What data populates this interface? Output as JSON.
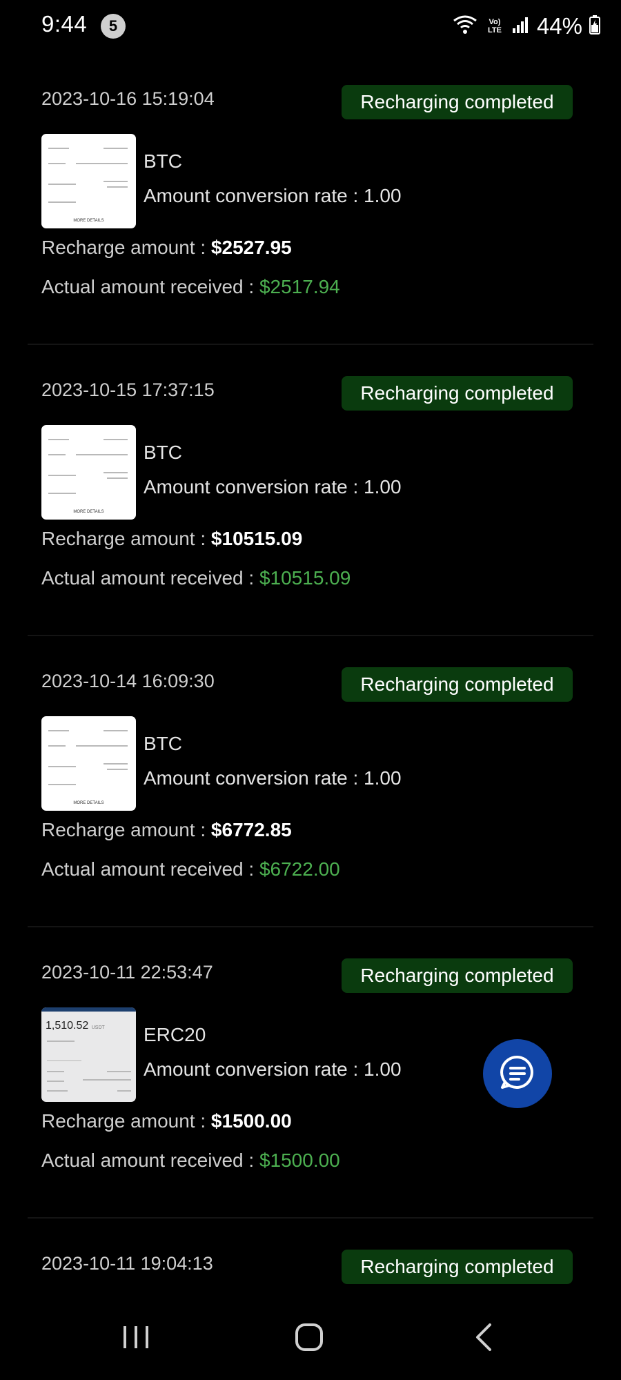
{
  "status_bar": {
    "time": "9:44",
    "notification_count": "5",
    "network_label": "Vo) LTE",
    "battery": "44%"
  },
  "records": [
    {
      "datetime": "2023-10-16 15:19:04",
      "status": "Recharging completed",
      "coin": "BTC",
      "rate_label": "Amount conversion rate : ",
      "rate_value": "1.00",
      "recharge_label": "Recharge amount : ",
      "recharge_value": "$2527.95",
      "received_label": "Actual amount received : ",
      "received_value": "$2517.94",
      "thumb_text": "MORE DETAILS"
    },
    {
      "datetime": "2023-10-15 17:37:15",
      "status": "Recharging completed",
      "coin": "BTC",
      "rate_label": "Amount conversion rate : ",
      "rate_value": "1.00",
      "recharge_label": "Recharge amount : ",
      "recharge_value": "$10515.09",
      "received_label": "Actual amount received : ",
      "received_value": "$10515.09",
      "thumb_text": "MORE DETAILS"
    },
    {
      "datetime": "2023-10-14 16:09:30",
      "status": "Recharging completed",
      "coin": "BTC",
      "rate_label": "Amount conversion rate : ",
      "rate_value": "1.00",
      "recharge_label": "Recharge amount : ",
      "recharge_value": "$6772.85",
      "received_label": "Actual amount received : ",
      "received_value": "$6722.00",
      "thumb_text": "MORE DETAILS"
    },
    {
      "datetime": "2023-10-11 22:53:47",
      "status": "Recharging completed",
      "coin": "ERC20",
      "rate_label": "Amount conversion rate : ",
      "rate_value": "1.00",
      "recharge_label": "Recharge amount : ",
      "recharge_value": "$1500.00",
      "received_label": "Actual amount received : ",
      "received_value": "$1500.00",
      "thumb_amount": "1,510.52",
      "thumb_unit": "USDT"
    },
    {
      "datetime": "2023-10-11 19:04:13",
      "status": "Recharging completed"
    }
  ],
  "colors": {
    "status_badge_bg": "#0a3b0e",
    "received_green": "#4caf50",
    "fab_blue": "#1145a7"
  },
  "icons": {
    "fab": "chat-bubble-icon",
    "nav": [
      "recent-apps-icon",
      "home-icon",
      "back-icon"
    ]
  }
}
